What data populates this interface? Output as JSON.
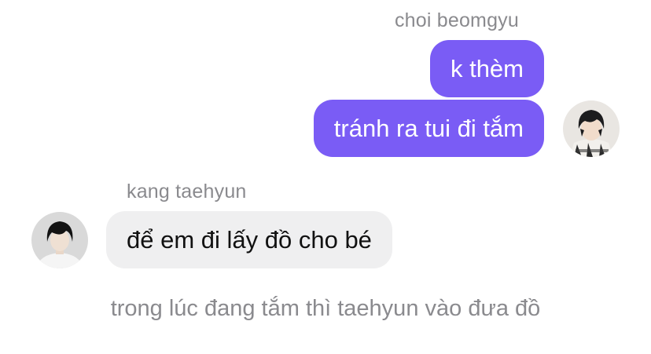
{
  "messages": [
    {
      "sender": "choi beomgyu",
      "direction": "outgoing",
      "bubbles": [
        "k thèm",
        "tránh ra tui đi tắm"
      ],
      "avatar_icon": "avatar-beomgyu-icon"
    },
    {
      "sender": "kang taehyun",
      "direction": "incoming",
      "bubbles": [
        "để em đi lấy đồ cho bé"
      ],
      "avatar_icon": "avatar-taehyun-icon"
    }
  ],
  "system_note": "trong lúc đang tắm thì taehyun vào đưa đồ",
  "colors": {
    "outgoing_bubble": "#7a5cf5",
    "incoming_bubble": "#efeff0",
    "meta_text": "#8a8a8e"
  }
}
